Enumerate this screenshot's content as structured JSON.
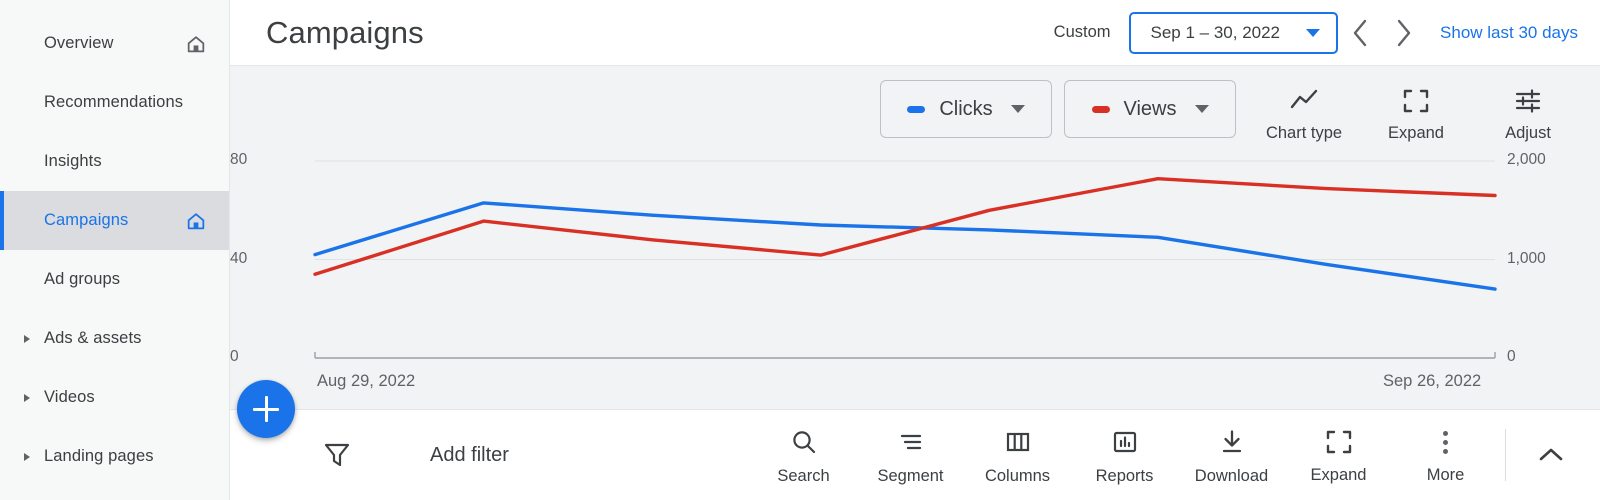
{
  "sidebar": {
    "items": [
      {
        "label": "Overview",
        "icon": "home-icon",
        "active": false,
        "caret": false
      },
      {
        "label": "Recommendations",
        "icon": null,
        "active": false,
        "caret": false
      },
      {
        "label": "Insights",
        "icon": null,
        "active": false,
        "caret": false
      },
      {
        "label": "Campaigns",
        "icon": "home-icon",
        "active": true,
        "caret": false
      },
      {
        "label": "Ad groups",
        "icon": null,
        "active": false,
        "caret": false
      },
      {
        "label": "Ads & assets",
        "icon": null,
        "active": false,
        "caret": true
      },
      {
        "label": "Videos",
        "icon": null,
        "active": false,
        "caret": true
      },
      {
        "label": "Landing pages",
        "icon": null,
        "active": false,
        "caret": true
      }
    ]
  },
  "header": {
    "title": "Campaigns",
    "range_type_label": "Custom",
    "date_range": "Sep 1 – 30, 2022",
    "prev_icon": "chevron-left-icon",
    "next_icon": "chevron-right-icon",
    "show_last_30_days": "Show last 30 days"
  },
  "chart_toolbar": {
    "metrics": [
      {
        "label": "Clicks",
        "color": "#1a73e8"
      },
      {
        "label": "Views",
        "color": "#d93025"
      }
    ],
    "tools": [
      {
        "label": "Chart type",
        "icon": "line-chart-icon"
      },
      {
        "label": "Expand",
        "icon": "expand-icon"
      },
      {
        "label": "Adjust",
        "icon": "sliders-icon"
      }
    ]
  },
  "chart_data": {
    "type": "line",
    "title": "",
    "xlabel": "",
    "ylabel": "",
    "grid": true,
    "legend_position": "top-right",
    "x_tick_labels": [
      "Aug 29, 2022",
      "Sep 26, 2022"
    ],
    "x_range": [
      "Aug 29, 2022",
      "Sep 26, 2022"
    ],
    "left_axis": {
      "name": "Clicks",
      "ticks": [
        "0",
        "40",
        "80"
      ],
      "tick_values": [
        0,
        40,
        80
      ],
      "ylim": [
        0,
        80
      ]
    },
    "right_axis": {
      "name": "Views",
      "ticks": [
        "0",
        "1,000",
        "2,000"
      ],
      "tick_values": [
        0,
        1000,
        2000
      ],
      "ylim": [
        0,
        2000
      ]
    },
    "x": [
      0,
      1,
      2,
      3,
      4,
      5,
      6,
      7
    ],
    "series": [
      {
        "name": "Clicks",
        "color": "#1a73e8",
        "axis": "left",
        "values": [
          42,
          63,
          58,
          54,
          52,
          49,
          38,
          28
        ]
      },
      {
        "name": "Views",
        "color": "#d93025",
        "axis": "right",
        "values": [
          850,
          1390,
          1200,
          1045,
          1500,
          1820,
          1720,
          1650
        ]
      }
    ]
  },
  "fab": {
    "icon": "plus-icon",
    "label": "Create"
  },
  "bottom_bar": {
    "filter_icon": "filter-icon",
    "add_filter_label": "Add filter",
    "actions": [
      {
        "label": "Search",
        "icon": "search-icon"
      },
      {
        "label": "Segment",
        "icon": "segment-icon"
      },
      {
        "label": "Columns",
        "icon": "columns-icon"
      },
      {
        "label": "Reports",
        "icon": "reports-icon"
      },
      {
        "label": "Download",
        "icon": "download-icon"
      },
      {
        "label": "Expand",
        "icon": "expand-icon"
      },
      {
        "label": "More",
        "icon": "more-vert-icon"
      }
    ],
    "collapse_icon": "chevron-up-icon"
  }
}
